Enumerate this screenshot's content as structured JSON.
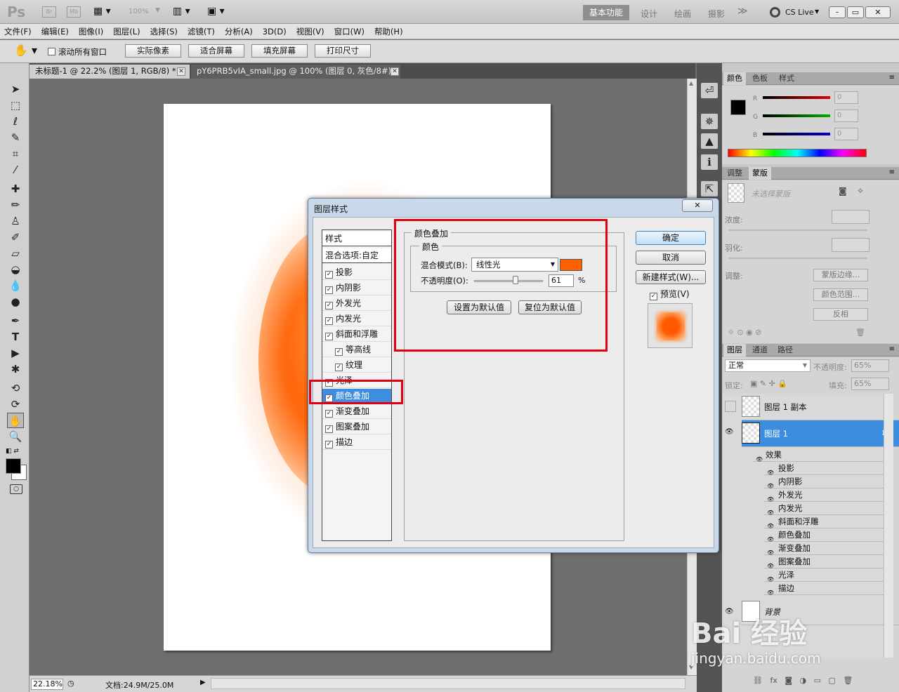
{
  "app": {
    "logo": "Ps",
    "bridge": "Br",
    "minibridge": "Mb",
    "zoom_preset": "100%",
    "workspaces": [
      "基本功能",
      "设计",
      "绘画",
      "摄影"
    ],
    "more": "≫",
    "cs_live": "CS Live",
    "window_controls": [
      "–",
      "▭",
      "✕"
    ]
  },
  "menu": [
    "文件(F)",
    "编辑(E)",
    "图像(I)",
    "图层(L)",
    "选择(S)",
    "滤镜(T)",
    "分析(A)",
    "3D(D)",
    "视图(V)",
    "窗口(W)",
    "帮助(H)"
  ],
  "options": {
    "scroll_all_label": "滚动所有窗口",
    "buttons": [
      "实际像素",
      "适合屏幕",
      "填充屏幕",
      "打印尺寸"
    ]
  },
  "doc_tabs": [
    {
      "title": "未标题-1 @ 22.2% (图层 1, RGB/8) *",
      "close": "✕"
    },
    {
      "title": "pY6PRB5vIA_small.jpg @ 100% (图层 0, 灰色/8#) *",
      "close": "✕"
    }
  ],
  "status": {
    "zoom": "22.18%",
    "doc": "文档:24.9M/25.0M"
  },
  "color_panel": {
    "tabs": [
      "颜色",
      "色板",
      "样式"
    ],
    "channels": [
      {
        "label": "R",
        "value": "0",
        "color": "#e00000"
      },
      {
        "label": "G",
        "value": "0",
        "color": "#00b000"
      },
      {
        "label": "B",
        "value": "0",
        "color": "#0000d0"
      }
    ]
  },
  "adjust_panel": {
    "tabs": [
      "调整",
      "蒙版"
    ],
    "no_mask": "未选择蒙版",
    "density": "浓度:",
    "feather": "羽化:",
    "adjust": "调整:",
    "buttons": [
      "蒙版边缘...",
      "颜色范围...",
      "反相"
    ]
  },
  "layers_panel": {
    "tabs": [
      "图层",
      "通道",
      "路径"
    ],
    "blend_mode": "正常",
    "opacity_label": "不透明度:",
    "opacity_value": "65%",
    "lock_label": "锁定:",
    "fill_label": "填充:",
    "fill_value": "65%",
    "layers": [
      {
        "name": "图层 1 副本"
      },
      {
        "name": "图层 1",
        "fx": "fx"
      }
    ],
    "effects_header": "效果",
    "effects": [
      "投影",
      "内阴影",
      "外发光",
      "内发光",
      "斜面和浮雕",
      "颜色叠加",
      "渐变叠加",
      "图案叠加",
      "光泽",
      "描边"
    ],
    "background": "背景"
  },
  "dialog": {
    "title": "图层样式",
    "close": "✕",
    "styles_header": "样式",
    "blend_options": "混合选项:自定",
    "style_items": [
      {
        "label": "投影",
        "indent": false
      },
      {
        "label": "内阴影",
        "indent": false
      },
      {
        "label": "外发光",
        "indent": false
      },
      {
        "label": "内发光",
        "indent": false
      },
      {
        "label": "斜面和浮雕",
        "indent": false
      },
      {
        "label": "等高线",
        "indent": true
      },
      {
        "label": "纹理",
        "indent": true
      },
      {
        "label": "光泽",
        "indent": false
      },
      {
        "label": "颜色叠加",
        "indent": false,
        "selected": true
      },
      {
        "label": "渐变叠加",
        "indent": false
      },
      {
        "label": "图案叠加",
        "indent": false
      },
      {
        "label": "描边",
        "indent": false
      }
    ],
    "group_title": "颜色叠加",
    "subgroup_title": "颜色",
    "blend_mode_label": "混合模式(B):",
    "blend_mode_value": "线性光",
    "overlay_color": "#ff6000",
    "opacity_label": "不透明度(O):",
    "opacity_value": "61",
    "opacity_unit": "%",
    "opacity_fraction": 0.61,
    "set_default": "设置为默认值",
    "reset_default": "复位为默认值",
    "ok": "确定",
    "cancel": "取消",
    "new_style": "新建样式(W)...",
    "preview": "预览(V)"
  },
  "watermark": {
    "logo": "Bai 经验",
    "url": "jingyan.baidu.com"
  }
}
